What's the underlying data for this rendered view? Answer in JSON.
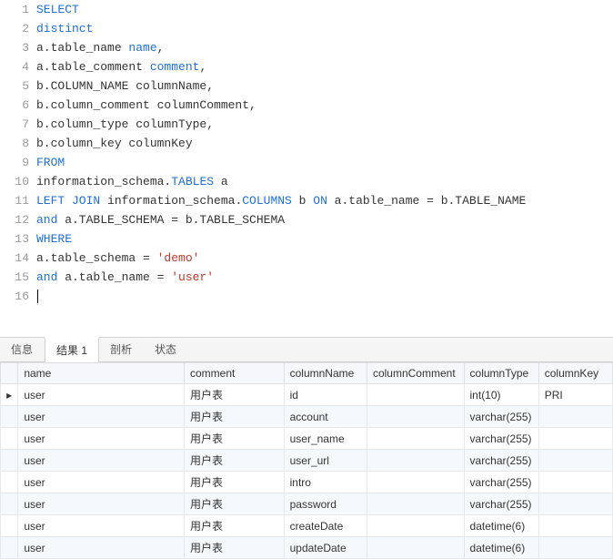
{
  "editor": {
    "line_count": 16,
    "tokens": {
      "l1": {
        "kw": "SELECT"
      },
      "l2": {
        "kw": "distinct"
      },
      "l3": {
        "t1": "a.table_name ",
        "a": "name",
        "t2": ","
      },
      "l4": {
        "t1": "a.table_comment ",
        "a": "comment",
        "t2": ","
      },
      "l5": {
        "t": "b.COLUMN_NAME columnName,"
      },
      "l6": {
        "t": "b.column_comment columnComment,"
      },
      "l7": {
        "t": "b.column_type columnType,"
      },
      "l8": {
        "t": "b.column_key columnKey"
      },
      "l9": {
        "kw": "FROM"
      },
      "l10": {
        "t1": "information_schema.",
        "tbl": "TABLES",
        "t2": " a"
      },
      "l11": {
        "kw1": "LEFT JOIN",
        "t1": " information_schema.",
        "tbl": "COLUMNS",
        "t2": " b ",
        "kw2": "ON",
        "t3": " a.table_name = b.TABLE_NAME"
      },
      "l12": {
        "kw": "and",
        "t": " a.TABLE_SCHEMA = b.TABLE_SCHEMA"
      },
      "l13": {
        "kw": "WHERE"
      },
      "l14": {
        "t1": "a.table_schema = ",
        "s": "'demo'"
      },
      "l15": {
        "kw": "and",
        "t1": " a.table_name = ",
        "s": "'user'"
      }
    }
  },
  "tabs": {
    "info": "信息",
    "result1": "结果 1",
    "profile": "剖析",
    "status": "状态"
  },
  "grid": {
    "headers": {
      "name": "name",
      "comment": "comment",
      "columnName": "columnName",
      "columnComment": "columnComment",
      "columnType": "columnType",
      "columnKey": "columnKey"
    },
    "rows": [
      {
        "name": "user",
        "comment": "用户表",
        "columnName": "id",
        "columnComment": "",
        "columnType": "int(10)",
        "columnKey": "PRI"
      },
      {
        "name": "user",
        "comment": "用户表",
        "columnName": "account",
        "columnComment": "",
        "columnType": "varchar(255)",
        "columnKey": ""
      },
      {
        "name": "user",
        "comment": "用户表",
        "columnName": "user_name",
        "columnComment": "",
        "columnType": "varchar(255)",
        "columnKey": ""
      },
      {
        "name": "user",
        "comment": "用户表",
        "columnName": "user_url",
        "columnComment": "",
        "columnType": "varchar(255)",
        "columnKey": ""
      },
      {
        "name": "user",
        "comment": "用户表",
        "columnName": "intro",
        "columnComment": "",
        "columnType": "varchar(255)",
        "columnKey": ""
      },
      {
        "name": "user",
        "comment": "用户表",
        "columnName": "password",
        "columnComment": "",
        "columnType": "varchar(255)",
        "columnKey": ""
      },
      {
        "name": "user",
        "comment": "用户表",
        "columnName": "createDate",
        "columnComment": "",
        "columnType": "datetime(6)",
        "columnKey": ""
      },
      {
        "name": "user",
        "comment": "用户表",
        "columnName": "updateDate",
        "columnComment": "",
        "columnType": "datetime(6)",
        "columnKey": ""
      }
    ]
  }
}
